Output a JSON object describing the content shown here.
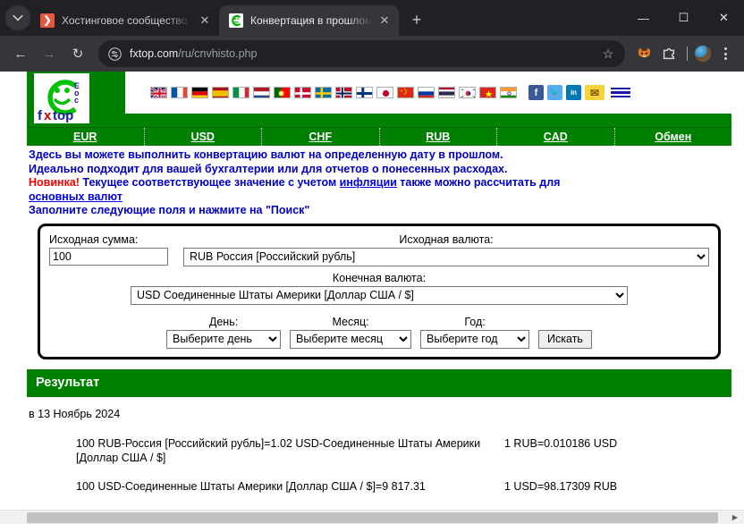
{
  "browser": {
    "tabs": [
      {
        "title": "Хостинговое сообщество «Tim",
        "favicon": "orange-arrow-icon",
        "active": false,
        "close_label": "✕"
      },
      {
        "title": "Конвертация в прошлом",
        "favicon": "fxtop-smiley-icon",
        "active": true,
        "close_label": "✕"
      }
    ],
    "new_tab_label": "+",
    "window_controls": {
      "minimize": "—",
      "maximize": "☐",
      "close": "✕"
    },
    "toolbar": {
      "back_label": "←",
      "forward_label": "→",
      "reload_label": "↻",
      "url_domain": "fxtop.com",
      "url_path": "/ru/cnvhisto.php",
      "bookmark_label": "☆",
      "extension_fox": "fox-extension-icon",
      "extension_puzzle": "extensions-puzzle-icon",
      "profile": "profile-avatar",
      "menu": "three-dot-menu-icon"
    }
  },
  "site": {
    "logo_alt": "fxtop",
    "logo_text_top": "Eco",
    "logo_text_bottom": "fxtop",
    "flags": [
      {
        "name": "flag-uk",
        "colors": [
          "#00247d",
          "#ffffff",
          "#cf142b"
        ]
      },
      {
        "name": "flag-france",
        "colors": [
          "#0055a4",
          "#ffffff",
          "#ef4135"
        ]
      },
      {
        "name": "flag-germany",
        "colors": [
          "#000000",
          "#dd0000",
          "#ffce00"
        ]
      },
      {
        "name": "flag-spain",
        "colors": [
          "#aa151b",
          "#f1bf00",
          "#aa151b"
        ]
      },
      {
        "name": "flag-italy",
        "colors": [
          "#009246",
          "#ffffff",
          "#ce2b37"
        ]
      },
      {
        "name": "flag-netherlands",
        "colors": [
          "#ae1c28",
          "#ffffff",
          "#21468b"
        ]
      },
      {
        "name": "flag-portugal",
        "colors": [
          "#006600",
          "#ff0000",
          "#ffd700"
        ]
      },
      {
        "name": "flag-denmark",
        "colors": [
          "#c60c30",
          "#ffffff",
          "#c60c30"
        ]
      },
      {
        "name": "flag-sweden",
        "colors": [
          "#006aa7",
          "#fecc00",
          "#006aa7"
        ]
      },
      {
        "name": "flag-norway",
        "colors": [
          "#ba0c2f",
          "#ffffff",
          "#00205b"
        ]
      },
      {
        "name": "flag-finland",
        "colors": [
          "#ffffff",
          "#003580",
          "#ffffff"
        ]
      },
      {
        "name": "flag-japan",
        "colors": [
          "#ffffff",
          "#bc002d",
          "#ffffff"
        ]
      },
      {
        "name": "flag-china",
        "colors": [
          "#de2910",
          "#ffde00",
          "#de2910"
        ]
      },
      {
        "name": "flag-russia",
        "colors": [
          "#ffffff",
          "#0039a6",
          "#d52b1e"
        ]
      },
      {
        "name": "flag-thailand",
        "colors": [
          "#a51931",
          "#ffffff",
          "#2d2a4a"
        ]
      },
      {
        "name": "flag-south-korea",
        "colors": [
          "#ffffff",
          "#cd2e3a",
          "#0047a0"
        ]
      },
      {
        "name": "flag-vietnam",
        "colors": [
          "#da251d",
          "#ffff00",
          "#da251d"
        ]
      },
      {
        "name": "flag-india",
        "colors": [
          "#ff9933",
          "#ffffff",
          "#138808"
        ]
      }
    ],
    "social": [
      {
        "name": "facebook-icon",
        "glyph": "f",
        "color": "#3b5998"
      },
      {
        "name": "twitter-icon",
        "glyph": "t",
        "color": "#55acee"
      },
      {
        "name": "linkedin-icon",
        "glyph": "in",
        "color": "#0077b5"
      },
      {
        "name": "email-icon",
        "glyph": "✉",
        "color": "#ffd700"
      }
    ],
    "menu_icon": "hamburger-menu-icon",
    "nav": [
      {
        "label": "EUR"
      },
      {
        "label": "USD"
      },
      {
        "label": "CHF"
      },
      {
        "label": "RUB"
      },
      {
        "label": "CAD"
      },
      {
        "label": "Обмен"
      }
    ],
    "intro": {
      "line1": "Здесь вы можете выполнить конвертацию валют на определенную дату в прошлом.",
      "line2": "Идеально подходит для вашей бухгалтерии или для отчетов о понесенных расходах.",
      "new_badge": "Новинка!",
      "line3_before": " Текущее соответствующее значение с учетом ",
      "line3_link": "инфляции",
      "line3_after": " также можно рассчитать для ",
      "line3_link2": "основных валют",
      "line4": "Заполните следующие поля и нажмите на \"Поиск\""
    }
  },
  "form": {
    "amount_label": "Исходная сумма:",
    "amount_value": "100",
    "source_label": "Исходная валюта:",
    "source_value": "RUB Россия [Российский рубль]",
    "target_label": "Конечная валюта:",
    "target_value": "USD Соединенные Штаты Америки [Доллар США / $]",
    "day_label": "День:",
    "day_value": "Выберите день",
    "month_label": "Месяц:",
    "month_value": "Выберите месяц",
    "year_label": "Год:",
    "year_value": "Выберите год",
    "submit_label": "Искать"
  },
  "result": {
    "heading": "Результат",
    "date_line": "в 13 Ноябрь 2024",
    "rows": [
      {
        "conversion": "100 RUB-Россия [Российский рубль]=1.02 USD-Соединенные Штаты Америки [Доллар США / $]",
        "rate": "1 RUB=0.010186 USD"
      },
      {
        "conversion": "100 USD-Соединенные Штаты Америки [Доллар США / $]=9 817.31",
        "rate": "1 USD=98.17309 RUB"
      }
    ]
  },
  "colors": {
    "brand_green": "#008000",
    "link_blue": "#0000c8",
    "accent_red": "#ff0000"
  }
}
